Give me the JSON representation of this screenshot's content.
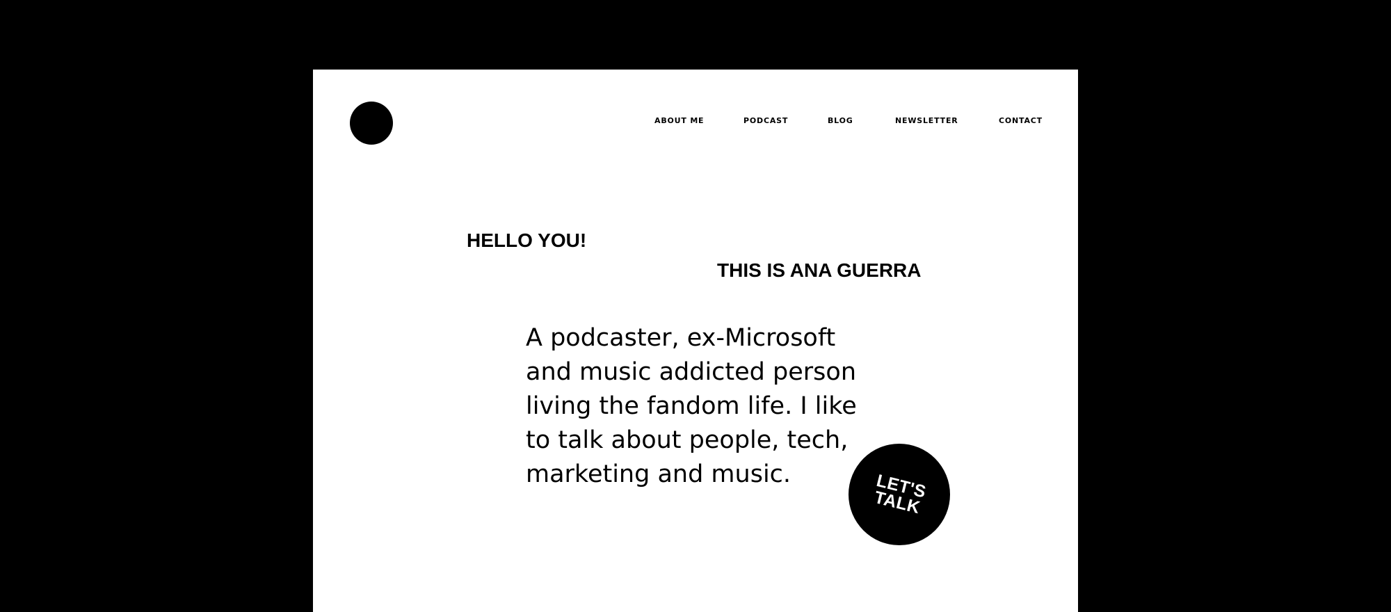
{
  "header": {
    "logo": "black-circle-logo",
    "nav": [
      {
        "label": "ABOUT ME"
      },
      {
        "label": "PODCAST"
      },
      {
        "label": "BLOG"
      },
      {
        "label": "NEWSLETTER"
      },
      {
        "label": "CONTACT"
      }
    ]
  },
  "hero": {
    "greeting": "HELLO YOU!",
    "name_line": "THIS IS ANA GUERRA",
    "bio_lines": [
      "A podcaster, ex-Microsoft",
      "and music addicted person",
      "living the fandom life. I like",
      "to talk about people, tech,",
      "marketing and music."
    ]
  },
  "cta": {
    "line1": "LET'S",
    "line2": "TALK"
  },
  "colors": {
    "background": "#000000",
    "page": "#ffffff",
    "text": "#000000",
    "cta_text": "#ffffff"
  }
}
